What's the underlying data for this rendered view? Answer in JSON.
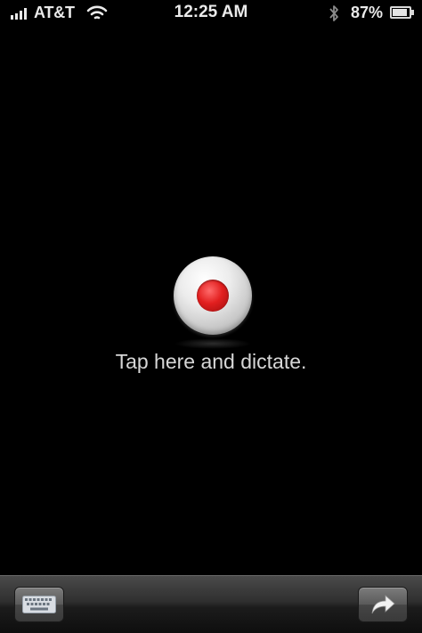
{
  "status_bar": {
    "carrier": "AT&T",
    "time": "12:25 AM",
    "battery_percent": "87%",
    "battery_level": 0.87,
    "icons": [
      "signal-bars-icon",
      "wifi-icon",
      "bluetooth-icon",
      "battery-icon"
    ]
  },
  "dictation": {
    "prompt": "Tap here and dictate.",
    "record_button_icon": "record-icon"
  },
  "toolbar": {
    "left_icon": "keyboard-icon",
    "right_icon": "share-arrow-icon"
  },
  "colors": {
    "background": "#000000",
    "record_red": "#e21f1f",
    "toolbar_dark": "#1c1c1c"
  }
}
